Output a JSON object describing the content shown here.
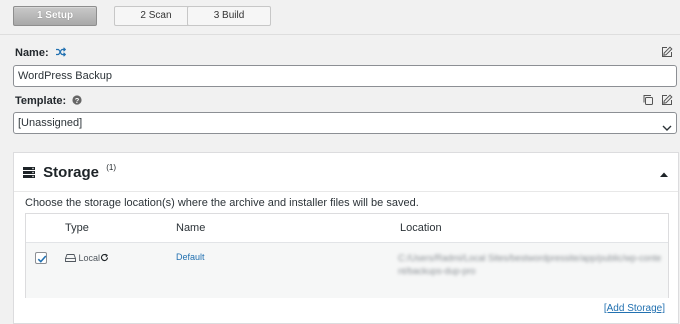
{
  "steps": [
    {
      "label": "1 Setup",
      "active": true
    },
    {
      "label": "2 Scan",
      "active": false
    },
    {
      "label": "3 Build",
      "active": false
    }
  ],
  "name_field": {
    "label": "Name:",
    "value": "WordPress Backup"
  },
  "template_field": {
    "label": "Template:",
    "value": "[Unassigned]"
  },
  "storage": {
    "title": "Storage",
    "title_sup": "(1)",
    "description": "Choose the storage location(s) where the archive and installer files will be saved.",
    "columns": {
      "type": "Type",
      "name": "Name",
      "location": "Location"
    },
    "rows": [
      {
        "checked": true,
        "type": "Local",
        "name": "Default",
        "location": "C:/Users/Radmi/Local Sites/bestwordpressite/app/public/wp-content/backups-dup-pro"
      }
    ],
    "add_link": "[Add Storage]"
  },
  "colors": {
    "link": "#2271b1",
    "accent_icon": "#2271b1"
  }
}
